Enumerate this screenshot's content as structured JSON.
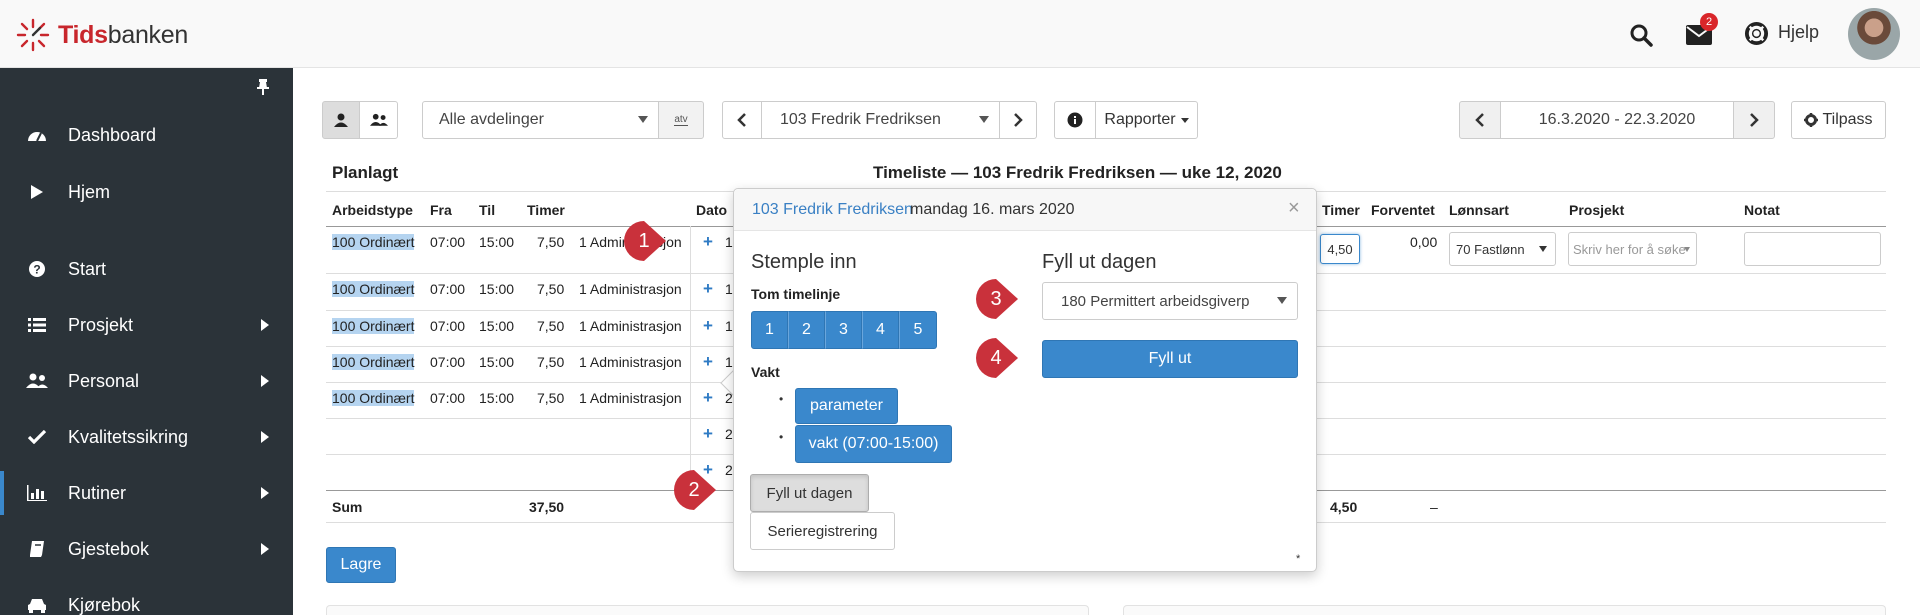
{
  "app": {
    "logo_part1": "Tids",
    "logo_part2": "banken"
  },
  "topbar": {
    "messages_badge": "2",
    "help_label": "Hjelp"
  },
  "sidebar": {
    "items": [
      {
        "label": "Dashboard",
        "icon": "dashboard-icon"
      },
      {
        "label": "Hjem",
        "icon": "play-icon"
      },
      {
        "label": "Start",
        "icon": "question-circle-icon"
      },
      {
        "label": "Prosjekt",
        "icon": "list-icon"
      },
      {
        "label": "Personal",
        "icon": "users-icon"
      },
      {
        "label": "Kvalitetssikring",
        "icon": "check-icon"
      },
      {
        "label": "Rutiner",
        "icon": "bar-chart-icon"
      },
      {
        "label": "Gjestebok",
        "icon": "book-icon"
      },
      {
        "label": "Kjørebok",
        "icon": "car-icon"
      }
    ]
  },
  "toolbar": {
    "department": "Alle avdelinger",
    "atv_label": "atv",
    "employee": "103 Fredrik Fredriksen",
    "reports_label": "Rapporter",
    "date_range": "16.3.2020 - 22.3.2020",
    "customize_label": "Tilpass"
  },
  "main": {
    "planned_title": "Planlagt",
    "timesheet_title": "Timeliste — 103 Fredrik Fredriksen — uke 12, 2020",
    "planned_headers": [
      "Arbeidstype",
      "Fra",
      "Til",
      "Timer"
    ],
    "date_header": "Dato",
    "right_headers": [
      "Timer",
      "Forventet",
      "Lønnsart",
      "Prosjekt",
      "Notat"
    ],
    "planned_rows": [
      {
        "type": "100 Ordinært",
        "from": "07:00",
        "to": "15:00",
        "hours": "7,50",
        "dept": "1 Administrasjon",
        "date_prefix": "1"
      },
      {
        "type": "100 Ordinært",
        "from": "07:00",
        "to": "15:00",
        "hours": "7,50",
        "dept": "1 Administrasjon",
        "date_prefix": "1"
      },
      {
        "type": "100 Ordinært",
        "from": "07:00",
        "to": "15:00",
        "hours": "7,50",
        "dept": "1 Administrasjon",
        "date_prefix": "1"
      },
      {
        "type": "100 Ordinært",
        "from": "07:00",
        "to": "15:00",
        "hours": "7,50",
        "dept": "1 Administrasjon",
        "date_prefix": "1"
      },
      {
        "type": "100 Ordinært",
        "from": "07:00",
        "to": "15:00",
        "hours": "7,50",
        "dept": "1 Administrasjon",
        "date_prefix": "2"
      }
    ],
    "extra_date_prefixes": [
      "2",
      "2"
    ],
    "first_row_right": {
      "hours_value": "4,50",
      "expected": "0,00",
      "wage_type": "70 Fastlønn",
      "project_placeholder": "Skriv her for å søke"
    },
    "sum_label": "Sum",
    "sum_planned": "37,50",
    "sum_hours": "4,50",
    "sum_expected": "–",
    "save_label": "Lagre"
  },
  "popover": {
    "employee_link": "103 Fredrik Fredriksen",
    "date_text": "mandag 16. mars 2020",
    "close": "×",
    "stamp_in_title": "Stemple inn",
    "empty_timeline_label": "Tom timelinje",
    "timeline_buttons": [
      "1",
      "2",
      "3",
      "4",
      "5"
    ],
    "shift_label": "Vakt",
    "shift_buttons": [
      "parameter",
      "vakt (07:00-15:00)"
    ],
    "fill_day_button": "Fyll ut dagen",
    "series_button": "Serieregistrering",
    "fill_day_title": "Fyll ut dagen",
    "fill_select_value": "180 Permittert arbeidsgiverp",
    "fill_button": "Fyll ut",
    "footnote": "*"
  },
  "markers": [
    "1",
    "2",
    "3",
    "4"
  ],
  "colors": {
    "primary": "#3a88cc",
    "sidebar": "#2b3339",
    "marker": "#c9313b",
    "brand": "#c8262c"
  }
}
